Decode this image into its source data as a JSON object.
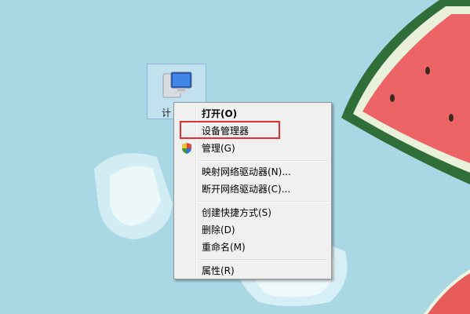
{
  "desktop": {
    "computer_icon_label": "计"
  },
  "context_menu": {
    "items": [
      {
        "label": "打开(O)",
        "bold": true
      },
      {
        "label": "设备管理器"
      },
      {
        "label": "管理(G)",
        "icon": "uac-shield-icon"
      },
      {
        "label": "映射网络驱动器(N)..."
      },
      {
        "label": "断开网络驱动器(C)..."
      },
      {
        "label": "创建快捷方式(S)"
      },
      {
        "label": "删除(D)"
      },
      {
        "label": "重命名(M)"
      },
      {
        "label": "属性(R)"
      }
    ],
    "highlighted_item": "设备管理器",
    "highlight_color": "#e03131"
  }
}
